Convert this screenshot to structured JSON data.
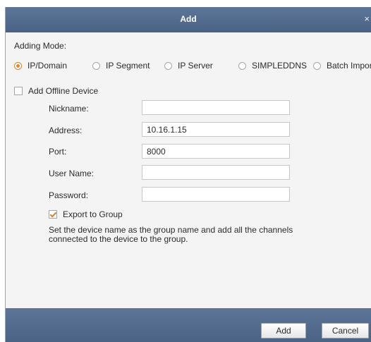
{
  "dialog": {
    "title": "Add",
    "close_glyph": "×"
  },
  "adding_mode": {
    "label": "Adding Mode:",
    "options": [
      {
        "label": "IP/Domain",
        "selected": true
      },
      {
        "label": "IP Segment",
        "selected": false
      },
      {
        "label": "IP Server",
        "selected": false
      },
      {
        "label": "SIMPLEDDNS",
        "selected": false
      },
      {
        "label": "Batch Import",
        "selected": false
      }
    ]
  },
  "offline_device": {
    "label": "Add Offline Device",
    "checked": false
  },
  "fields": {
    "nickname": {
      "label": "Nickname:",
      "value": ""
    },
    "address": {
      "label": "Address:",
      "value": "10.16.1.15"
    },
    "port": {
      "label": "Port:",
      "value": "8000"
    },
    "username": {
      "label": "User Name:",
      "value": ""
    },
    "password": {
      "label": "Password:",
      "value": ""
    }
  },
  "export_group": {
    "label": "Export to Group",
    "checked": true
  },
  "hint": "Set the device name as the group name and add all the channels connected to the device to the group.",
  "footer": {
    "add_label": "Add",
    "cancel_label": "Cancel"
  },
  "colors": {
    "titlebar": "#4f6a8f",
    "accent": "#e2882e",
    "background": "#f4f4f4"
  }
}
